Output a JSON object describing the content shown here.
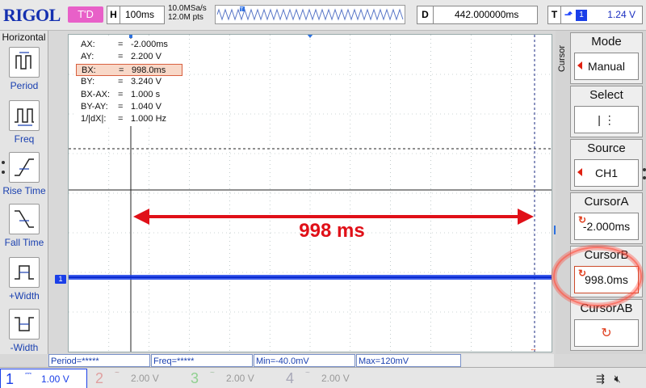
{
  "topbar": {
    "logo": "RIGOL",
    "trigger_status": "T'D",
    "horizontal": {
      "key": "H",
      "value": "100ms"
    },
    "sample_rate": "10.0MSa/s",
    "memory_depth": "12.0M pts",
    "delay": {
      "key": "D",
      "value": "442.000000ms"
    },
    "trigger": {
      "key": "T",
      "channel": "1",
      "level": "1.24 V",
      "edge_icon": "rising-edge-icon"
    }
  },
  "left_menu": {
    "title": "Horizontal",
    "items": [
      {
        "label": "Period",
        "icon": "period-icon"
      },
      {
        "label": "Freq",
        "icon": "frequency-icon"
      },
      {
        "label": "Rise Time",
        "icon": "rise-time-icon"
      },
      {
        "label": "Fall Time",
        "icon": "fall-time-icon"
      },
      {
        "label": "+Width",
        "icon": "positive-width-icon"
      },
      {
        "label": "-Width",
        "icon": "negative-width-icon"
      }
    ]
  },
  "cursor_info": [
    {
      "key": "AX:",
      "value": "-2.000ms"
    },
    {
      "key": "AY:",
      "value": "2.200 V"
    },
    {
      "key": "BX:",
      "value": "998.0ms",
      "highlight": true
    },
    {
      "key": "BY:",
      "value": "3.240 V"
    },
    {
      "key": "BX-AX:",
      "value": "1.000 s"
    },
    {
      "key": "BY-AY:",
      "value": "1.040 V"
    },
    {
      "key": "1/|dX|:",
      "value": "1.000 Hz"
    }
  ],
  "annotation": {
    "label": "998 ms",
    "color": "#e01018"
  },
  "waveform": {
    "channel_marker": "1",
    "color": "#1a3fe8"
  },
  "right_menu": {
    "title": "Cursor",
    "items": [
      {
        "head": "Mode",
        "value": "Manual"
      },
      {
        "head": "Select",
        "value": "|    ⋮"
      },
      {
        "head": "Source",
        "value": "CH1"
      },
      {
        "head": "CursorA",
        "value": "-2.000ms"
      },
      {
        "head": "CursorB",
        "value": "998.0ms"
      },
      {
        "head": "CursorAB",
        "value": ""
      }
    ]
  },
  "measure_bar": {
    "period": "Period=*****",
    "freq": "Freq=*****",
    "min": "Min=-40.0mV",
    "max": "Max=120mV"
  },
  "channels": [
    {
      "num": "1",
      "scale": "1.00 V",
      "color": "#1a3fe8",
      "active": true
    },
    {
      "num": "2",
      "scale": "2.00 V",
      "color": "#e07070",
      "active": false
    },
    {
      "num": "3",
      "scale": "2.00 V",
      "color": "#60c060",
      "active": false
    },
    {
      "num": "4",
      "scale": "2.00 V",
      "color": "#9090a0",
      "active": false
    }
  ],
  "system_icons": [
    "usb-icon",
    "sound-muted-icon"
  ]
}
